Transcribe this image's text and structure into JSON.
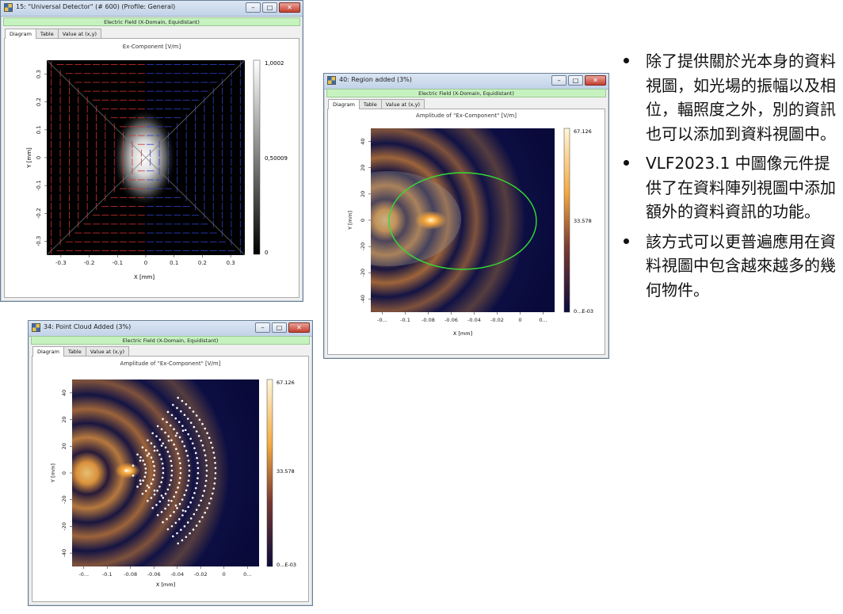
{
  "windows": {
    "w1": {
      "title": "15: \"Universal Detector\" (# 600) (Profile: General)",
      "subtitle": "Electric Field (X-Domain, Equidistant)",
      "tabs": [
        "Diagram",
        "Table",
        "Value at (x,y)"
      ],
      "plot_title": "Ex-Component  [V/m]",
      "colorbar": {
        "max": "1,0002",
        "mid": "0,50009",
        "min": "0"
      }
    },
    "w2": {
      "title": "40: Region added (3%)",
      "subtitle": "Electric Field (X-Domain, Equidistant)",
      "tabs": [
        "Diagram",
        "Table",
        "Value at (x,y)"
      ],
      "plot_title": "Amplitude of \"Ex-Component\"  [V/m]",
      "colorbar": {
        "max": "67.126",
        "mid": "33.578",
        "min": "0...E-03"
      }
    },
    "w3": {
      "title": "34: Point Cloud Added (3%)",
      "subtitle": "Electric Field (X-Domain, Equidistant)",
      "tabs": [
        "Diagram",
        "Table",
        "Value at (x,y)"
      ],
      "plot_title": "Amplitude of \"Ex-Component\"  [V/m]",
      "colorbar": {
        "max": "67.126",
        "mid": "33.578",
        "min": "0...E-03"
      }
    }
  },
  "chart_data": [
    {
      "type": "heatmap",
      "title": "Ex-Component  [V/m]",
      "xlabel": "X [mm]",
      "ylabel": "Y [mm]",
      "x_ticks": [
        "-0.3",
        "-0.2",
        "-0.1",
        "0",
        "0.1",
        "0.2",
        "0.3"
      ],
      "y_ticks": [
        "0.3",
        "0.2",
        "0.1",
        "0",
        "-0.1",
        "-0.2",
        "-0.3"
      ],
      "colorbar_range": [
        0,
        1.0002
      ]
    },
    {
      "type": "heatmap",
      "title": "Amplitude of \"Ex-Component\"  [V/m]",
      "xlabel": "X [mm]",
      "ylabel": "Y [mm]",
      "x_ticks": [
        "-0...",
        "-0.1",
        "-0.08",
        "-0.06",
        "-0.04",
        "-0.02",
        "0",
        "0..."
      ],
      "y_ticks": [
        "40",
        "20",
        "20",
        "0",
        "-20",
        "-20",
        "-40"
      ],
      "colorbar_range": [
        0,
        67.126
      ]
    },
    {
      "type": "heatmap",
      "title": "Amplitude of \"Ex-Component\"  [V/m]",
      "xlabel": "X [mm]",
      "ylabel": "Y [mm]",
      "x_ticks": [
        "-0...",
        "-0.1",
        "-0.08",
        "-0.06",
        "-0.04",
        "-0.02",
        "0",
        "0..."
      ],
      "y_ticks": [
        "40",
        "20",
        "20",
        "0",
        "-20",
        "-20",
        "-40"
      ],
      "colorbar_range": [
        0,
        67.126
      ]
    }
  ],
  "bullets": [
    "除了提供關於光本身的資料視圖，如光場的振幅以及相位，輻照度之外，別的資訊也可以添加到資料視圖中。",
    "VLF2023.1 中圖像元件提供了在資料陣列視圖中添加額外的資料資訊的功能。",
    "該方式可以更普遍應用在資料視圖中包含越來越多的幾何物件。"
  ],
  "colors": {
    "title_bar": "#c2d3e8",
    "green_bar": "#c6f2c0",
    "ellipse": "#33dd33",
    "field_dark": "#090a3a",
    "field_bright": "#f6b14c"
  }
}
